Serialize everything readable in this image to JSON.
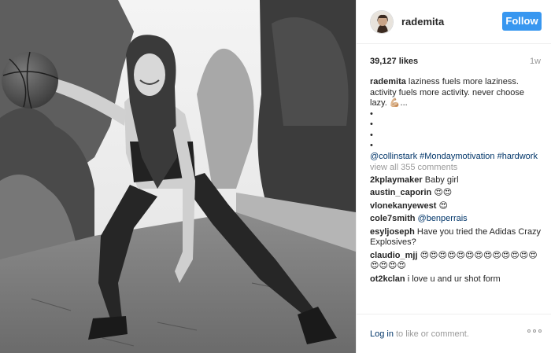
{
  "author": {
    "username": "rademita",
    "follow_label": "Follow"
  },
  "likes": "39,127 likes",
  "age": "1w",
  "caption": {
    "username": "rademita",
    "text": "laziness fuels more laziness. activity fuels more activity. never choose lazy. 💪🏼...",
    "bullets": [
      "•",
      "•",
      "•",
      "•"
    ],
    "mention": "@collinstark",
    "hashtag1": "#Mondaymotivation",
    "hashtag2": "#hardwork"
  },
  "view_all": "view all 355 comments",
  "comments": [
    {
      "user": "2kplaymaker",
      "text": "Baby girl"
    },
    {
      "user": "austin_caporin",
      "text": "😍😍"
    },
    {
      "user": "vlonekanyewest",
      "text": "😍"
    },
    {
      "user": "cole7smith",
      "text": "@benperrais"
    },
    {
      "user": "esyljoseph",
      "text": "Have you tried the Adidas Crazy Explosives?"
    },
    {
      "user": "claudio_mjj",
      "text": "😍😍😍😍😍😍😍😍😍😍😍😍😍😍😍😍😍"
    },
    {
      "user": "ot2kclan",
      "text": "i love u and ur shot form"
    }
  ],
  "footer": {
    "login": "Log in",
    "rest": "to like or comment."
  },
  "icons": {
    "more": "more-options-icon",
    "avatar": "avatar"
  }
}
